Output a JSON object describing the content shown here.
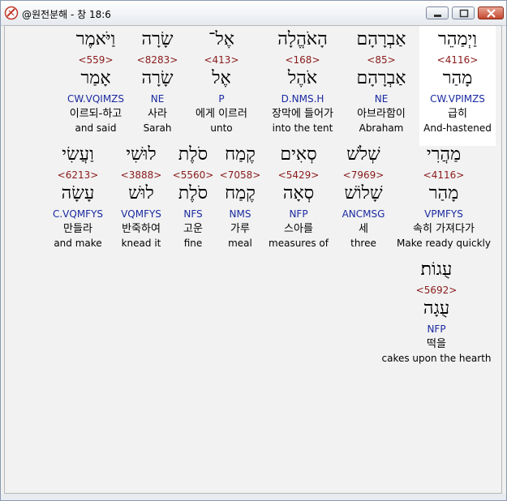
{
  "window": {
    "title": "@원전분해 - 창 18:6"
  },
  "rows": [
    [
      {
        "heb": "וַיְמַהֵר",
        "strong": "<4116>",
        "lex": "מָהַר",
        "parse": "CW.VPIMZS",
        "kor": "급히",
        "eng": "And-hastened",
        "highlight": true
      },
      {
        "heb": "אַבְרָהָם",
        "strong": "<85>",
        "lex": "אַבְרָהָם",
        "parse": "NE",
        "kor": "아브라함이",
        "eng": "Abraham"
      },
      {
        "heb": "הָאֹהֱלָה",
        "strong": "<168>",
        "lex": "אֹהֶל",
        "parse": "D.NMS.H",
        "kor": "장막에 들어가",
        "eng": "into the tent"
      },
      {
        "heb": "אֶל־",
        "strong": "<413>",
        "lex": "אֶל",
        "parse": "P",
        "kor": "에게 이르러",
        "eng": "unto"
      },
      {
        "heb": "שָׂרָה",
        "strong": "<8283>",
        "lex": "שָׂרָה",
        "parse": "NE",
        "kor": "사라",
        "eng": "Sarah"
      },
      {
        "heb": "וַיֹּאמֶר",
        "strong": "<559>",
        "lex": "אָמַר",
        "parse": "CW.VQIMZS",
        "kor": "이르되-하고",
        "eng": "and said"
      }
    ],
    [
      {
        "heb": "מַהֲרִי",
        "strong": "<4116>",
        "lex": "מָהַר",
        "parse": "VPMFYS",
        "kor": "속히 가져다가",
        "eng": "Make ready quickly"
      },
      {
        "heb": "שְׁלֹשׁ",
        "strong": "<7969>",
        "lex": "שָׁלוֹשׁ",
        "parse": "ANCMSG",
        "kor": "세",
        "eng": "three"
      },
      {
        "heb": "סְאִים",
        "strong": "<5429>",
        "lex": "סְאָה",
        "parse": "NFP",
        "kor": "스아를",
        "eng": "measures of"
      },
      {
        "heb": "קֶמַח",
        "strong": "<7058>",
        "lex": "קֶמַח",
        "parse": "NMS",
        "kor": "가루",
        "eng": "meal"
      },
      {
        "heb": "סֹלֶת",
        "strong": "<5560>",
        "lex": "סֹלֶת",
        "parse": "NFS",
        "kor": "고운",
        "eng": "fine"
      },
      {
        "heb": "לוּשִׁי",
        "strong": "<3888>",
        "lex": "לוּשׁ",
        "parse": "VQMFYS",
        "kor": "반죽하여",
        "eng": "knead it"
      },
      {
        "heb": "וַעֲשִׂי",
        "strong": "<6213>",
        "lex": "עָשָׂה",
        "parse": "C.VQMFYS",
        "kor": "만들라",
        "eng": "and make"
      }
    ],
    [
      {
        "heb": "עֻגוֹת׃",
        "strong": "<5692>",
        "lex": "עֻגָה",
        "parse": "NFP",
        "kor": "떡을",
        "eng": "cakes upon the hearth"
      }
    ]
  ]
}
